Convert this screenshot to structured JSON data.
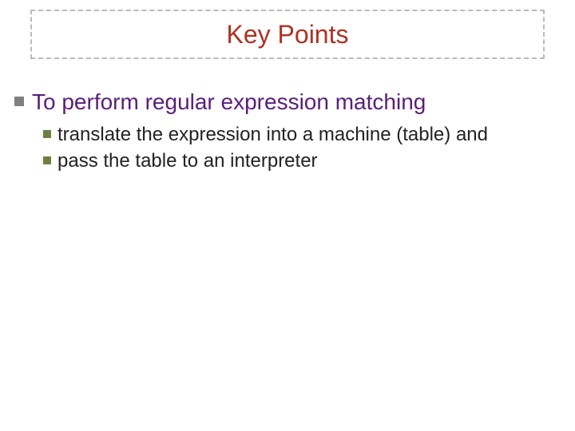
{
  "title": "Key Points",
  "points": {
    "main": "To perform regular expression matching",
    "sub1": "translate the expression into a machine (table) and",
    "sub2": "pass the table to an interpreter"
  }
}
